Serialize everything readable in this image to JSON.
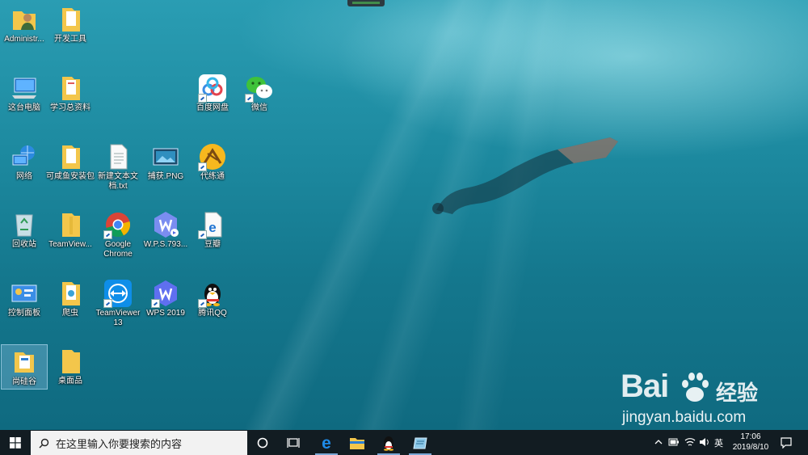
{
  "desktop": {
    "icons": [
      {
        "id": "admin",
        "label": "Administr...",
        "icon": "user-folder-icon"
      },
      {
        "id": "devtools",
        "label": "开发工具",
        "icon": "folder-icon"
      },
      {
        "id": "thispc",
        "label": "这台电脑",
        "icon": "computer-icon"
      },
      {
        "id": "study",
        "label": "学习总资料",
        "icon": "folder-icon"
      },
      {
        "id": "baidu",
        "label": "百度网盘",
        "icon": "baidu-netdisk-icon"
      },
      {
        "id": "wechat",
        "label": "微信",
        "icon": "wechat-icon"
      },
      {
        "id": "network",
        "label": "网络",
        "icon": "network-icon"
      },
      {
        "id": "xianyu",
        "label": "可咸鱼安装包",
        "icon": "folder-icon"
      },
      {
        "id": "newtxt",
        "label": "新建文本文\n档.txt",
        "icon": "text-file-icon"
      },
      {
        "id": "capture",
        "label": "捕获.PNG",
        "icon": "image-file-icon"
      },
      {
        "id": "dailian",
        "label": "代练通",
        "icon": "dailiantong-icon"
      },
      {
        "id": "recycle",
        "label": "回收站",
        "icon": "recycle-bin-icon"
      },
      {
        "id": "tvfolder",
        "label": "TeamView...",
        "icon": "folder-icon"
      },
      {
        "id": "chrome",
        "label": "Google\nChrome",
        "icon": "chrome-icon"
      },
      {
        "id": "wps793",
        "label": "W.P.S.793...",
        "icon": "wps-installer-icon"
      },
      {
        "id": "douban",
        "label": "豆瓣",
        "icon": "edge-icon"
      },
      {
        "id": "control",
        "label": "控制面板",
        "icon": "control-panel-icon"
      },
      {
        "id": "crawler",
        "label": "爬虫",
        "icon": "folder-icon"
      },
      {
        "id": "tv13",
        "label": "TeamViewer\n13",
        "icon": "teamviewer-icon"
      },
      {
        "id": "wps2019",
        "label": "WPS 2019",
        "icon": "wps-icon"
      },
      {
        "id": "qq",
        "label": "腾讯QQ",
        "icon": "qq-icon"
      },
      {
        "id": "shangguigu",
        "label": "尚硅谷",
        "icon": "folder-icon"
      },
      {
        "id": "zmp",
        "label": "桌面品",
        "icon": "folder-icon"
      }
    ]
  },
  "watermark": {
    "brand": "Bai",
    "brand_suffix": "经验",
    "url": "jingyan.baidu.com"
  },
  "taskbar": {
    "search_placeholder": "在这里输入你要搜索的内容",
    "ime": "英",
    "time": "17:06",
    "date": "2019/8/10"
  },
  "colors": {
    "taskbar_bg": "#121c22",
    "folder_yellow": "#f3c64b",
    "accent_blue": "#1e73d2"
  }
}
